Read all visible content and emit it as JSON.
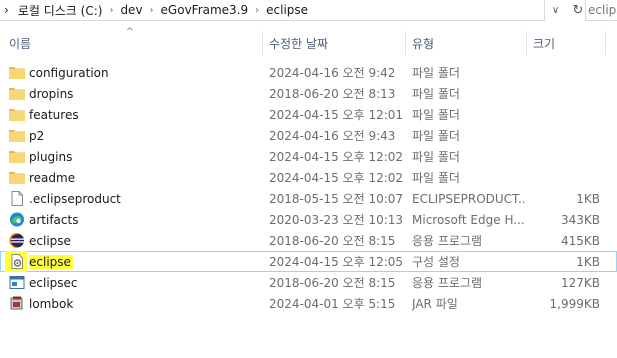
{
  "address_bar": {
    "lead_sep": "›",
    "path": [
      "로컬 디스크 (C:)",
      "dev",
      "eGovFrame3.9",
      "eclipse"
    ],
    "sep": "›"
  },
  "nav": {
    "dropdown_glyph": "∨",
    "refresh_glyph": "↻"
  },
  "search": {
    "placeholder": "eclipse 검색"
  },
  "columns": {
    "name": "이름",
    "date": "수정한 날짜",
    "type": "유형",
    "size": "크기"
  },
  "sort_indicator": "^",
  "files": [
    {
      "name": "configuration",
      "date": "2024-04-16 오전 9:42",
      "type": "파일 폴더",
      "size": "",
      "icon": "folder-icon"
    },
    {
      "name": "dropins",
      "date": "2018-06-20 오전 8:13",
      "type": "파일 폴더",
      "size": "",
      "icon": "folder-icon"
    },
    {
      "name": "features",
      "date": "2024-04-15 오후 12:01",
      "type": "파일 폴더",
      "size": "",
      "icon": "folder-icon"
    },
    {
      "name": "p2",
      "date": "2024-04-16 오전 9:43",
      "type": "파일 폴더",
      "size": "",
      "icon": "folder-icon"
    },
    {
      "name": "plugins",
      "date": "2024-04-15 오후 12:02",
      "type": "파일 폴더",
      "size": "",
      "icon": "folder-icon"
    },
    {
      "name": "readme",
      "date": "2024-04-15 오후 12:02",
      "type": "파일 폴더",
      "size": "",
      "icon": "folder-icon"
    },
    {
      "name": ".eclipseproduct",
      "date": "2018-05-15 오전 10:07",
      "type": "ECLIPSEPRODUCT...",
      "size": "1KB",
      "icon": "document-icon"
    },
    {
      "name": "artifacts",
      "date": "2020-03-23 오전 10:13",
      "type": "Microsoft Edge H...",
      "size": "343KB",
      "icon": "edge-icon"
    },
    {
      "name": "eclipse",
      "date": "2018-06-20 오전 8:15",
      "type": "응용 프로그램",
      "size": "415KB",
      "icon": "eclipse-app-icon"
    },
    {
      "name": "eclipse",
      "date": "2024-04-15 오후 12:05",
      "type": "구성 설정",
      "size": "1KB",
      "icon": "config-settings-icon",
      "highlighted": true,
      "selected": true
    },
    {
      "name": "eclipsec",
      "date": "2018-06-20 오전 8:15",
      "type": "응용 프로그램",
      "size": "127KB",
      "icon": "console-app-icon"
    },
    {
      "name": "lombok",
      "date": "2024-04-01 오후 5:15",
      "type": "JAR 파일",
      "size": "1,999KB",
      "icon": "jar-icon"
    }
  ],
  "colors": {
    "highlight": "#ffff3c",
    "selection_border": "#99d1ff",
    "header_text": "#4c607a",
    "folder": "#f8d775"
  }
}
